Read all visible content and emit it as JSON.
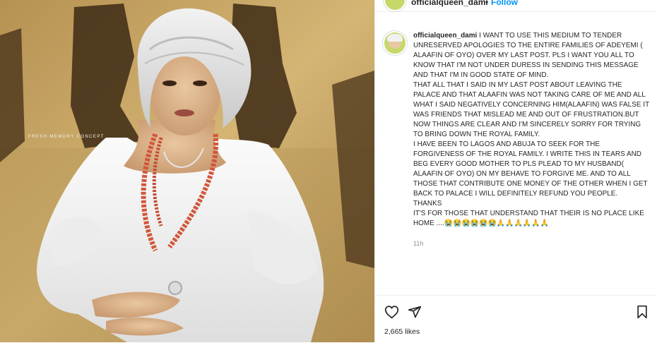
{
  "post": {
    "watermark": "FRESH MEMORY CONCEPT",
    "username": "officialqueen_dami",
    "separator": "•",
    "follow_label": "Follow",
    "more_icon": "more-horizontal-icon",
    "caption_paragraphs": [
      "I WANT TO USE THIS MEDIUM TO TENDER UNRESERVED APOLOGIES TO THE ENTIRE FAMILIES OF ADEYEMI ( ALAAFIN OF OYO) OVER MY LAST POST. PLS I WANT YOU ALL TO KNOW THAT I'M NOT UNDER DURESS IN SENDING THIS MESSAGE AND THAT I'M IN GOOD STATE OF MIND.",
      "THAT ALL THAT I SAID IN MY LAST POST ABOUT LEAVING THE PALACE AND THAT ALAAFIN WAS NOT TAKING CARE OF ME AND ALL WHAT I SAID NEGATIVELY CONCERNING HIM(ALAAFIN) WAS FALSE IT WAS FRIENDS THAT MISLEAD ME AND OUT OF FRUSTRATION.BUT NOW THINGS ARE CLEAR AND I'M SINCERELY SORRY FOR TRYING TO BRING DOWN THE ROYAL FAMILY.",
      "I HAVE BEEN TO LAGOS AND ABUJA TO SEEK FOR THE FORGIVENESS OF THE ROYAL FAMILY. I WRITE THIS IN TEARS AND BEG EVERY GOOD MOTHER TO PLS PLEAD TO MY HUSBAND( ALAAFIN OF OYO) ON MY BEHAVE TO FORGIVE ME. AND TO ALL THOSE THAT CONTRIBUTE ONE MONEY OF THE OTHER WHEN I GET BACK TO PALACE I WILL DEFINITELY REFUND YOU PEOPLE.",
      "THANKS",
      "IT'S FOR THOSE THAT UNDERSTAND THAT THEIR IS NO PLACE LIKE HOME ....😭😭😭😭😭😭🙏🙏🙏🙏🙏🙏"
    ],
    "time_ago": "11h",
    "likes": "2,665 likes",
    "icons": {
      "like": "heart-icon",
      "share": "send-icon",
      "save": "bookmark-icon"
    },
    "colors": {
      "link_blue": "#0095f6",
      "text": "#262626",
      "muted": "#8e8e8e"
    }
  }
}
